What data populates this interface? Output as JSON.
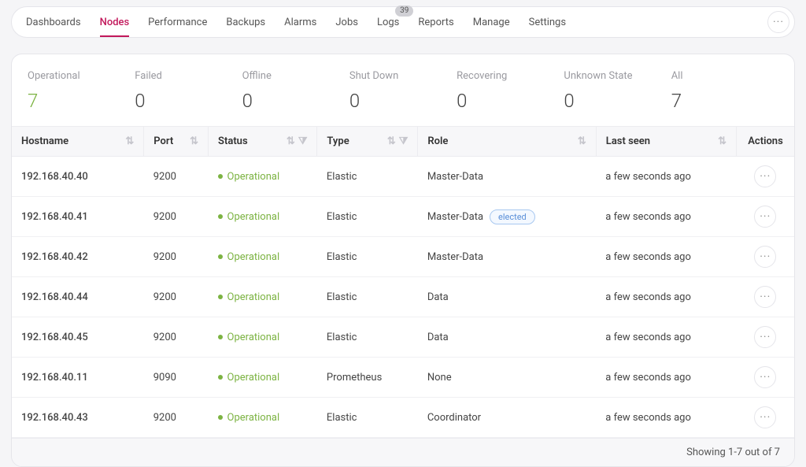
{
  "nav": {
    "tabs": [
      {
        "label": "Dashboards"
      },
      {
        "label": "Nodes",
        "active": true
      },
      {
        "label": "Performance"
      },
      {
        "label": "Backups"
      },
      {
        "label": "Alarms"
      },
      {
        "label": "Jobs"
      },
      {
        "label": "Logs",
        "badge": "39"
      },
      {
        "label": "Reports"
      },
      {
        "label": "Manage"
      },
      {
        "label": "Settings"
      }
    ]
  },
  "stats": [
    {
      "label": "Operational",
      "value": "7",
      "highlight": true
    },
    {
      "label": "Failed",
      "value": "0"
    },
    {
      "label": "Offline",
      "value": "0"
    },
    {
      "label": "Shut Down",
      "value": "0"
    },
    {
      "label": "Recovering",
      "value": "0"
    },
    {
      "label": "Unknown State",
      "value": "0"
    },
    {
      "label": "All",
      "value": "7"
    }
  ],
  "table": {
    "columns": {
      "hostname": "Hostname",
      "port": "Port",
      "status": "Status",
      "type": "Type",
      "role": "Role",
      "lastseen": "Last seen",
      "actions": "Actions"
    },
    "rows": [
      {
        "hostname": "192.168.40.40",
        "port": "9200",
        "status": "Operational",
        "type": "Elastic",
        "role": "Master-Data",
        "elected": false,
        "lastseen": "a few seconds ago"
      },
      {
        "hostname": "192.168.40.41",
        "port": "9200",
        "status": "Operational",
        "type": "Elastic",
        "role": "Master-Data",
        "elected": true,
        "lastseen": "a few seconds ago"
      },
      {
        "hostname": "192.168.40.42",
        "port": "9200",
        "status": "Operational",
        "type": "Elastic",
        "role": "Master-Data",
        "elected": false,
        "lastseen": "a few seconds ago"
      },
      {
        "hostname": "192.168.40.44",
        "port": "9200",
        "status": "Operational",
        "type": "Elastic",
        "role": "Data",
        "elected": false,
        "lastseen": "a few seconds ago"
      },
      {
        "hostname": "192.168.40.45",
        "port": "9200",
        "status": "Operational",
        "type": "Elastic",
        "role": "Data",
        "elected": false,
        "lastseen": "a few seconds ago"
      },
      {
        "hostname": "192.168.40.11",
        "port": "9090",
        "status": "Operational",
        "type": "Prometheus",
        "role": "None",
        "elected": false,
        "lastseen": "a few seconds ago"
      },
      {
        "hostname": "192.168.40.43",
        "port": "9200",
        "status": "Operational",
        "type": "Elastic",
        "role": "Coordinator",
        "elected": false,
        "lastseen": "a few seconds ago"
      }
    ],
    "elected_label": "elected",
    "footer": "Showing 1-7 out of 7"
  }
}
